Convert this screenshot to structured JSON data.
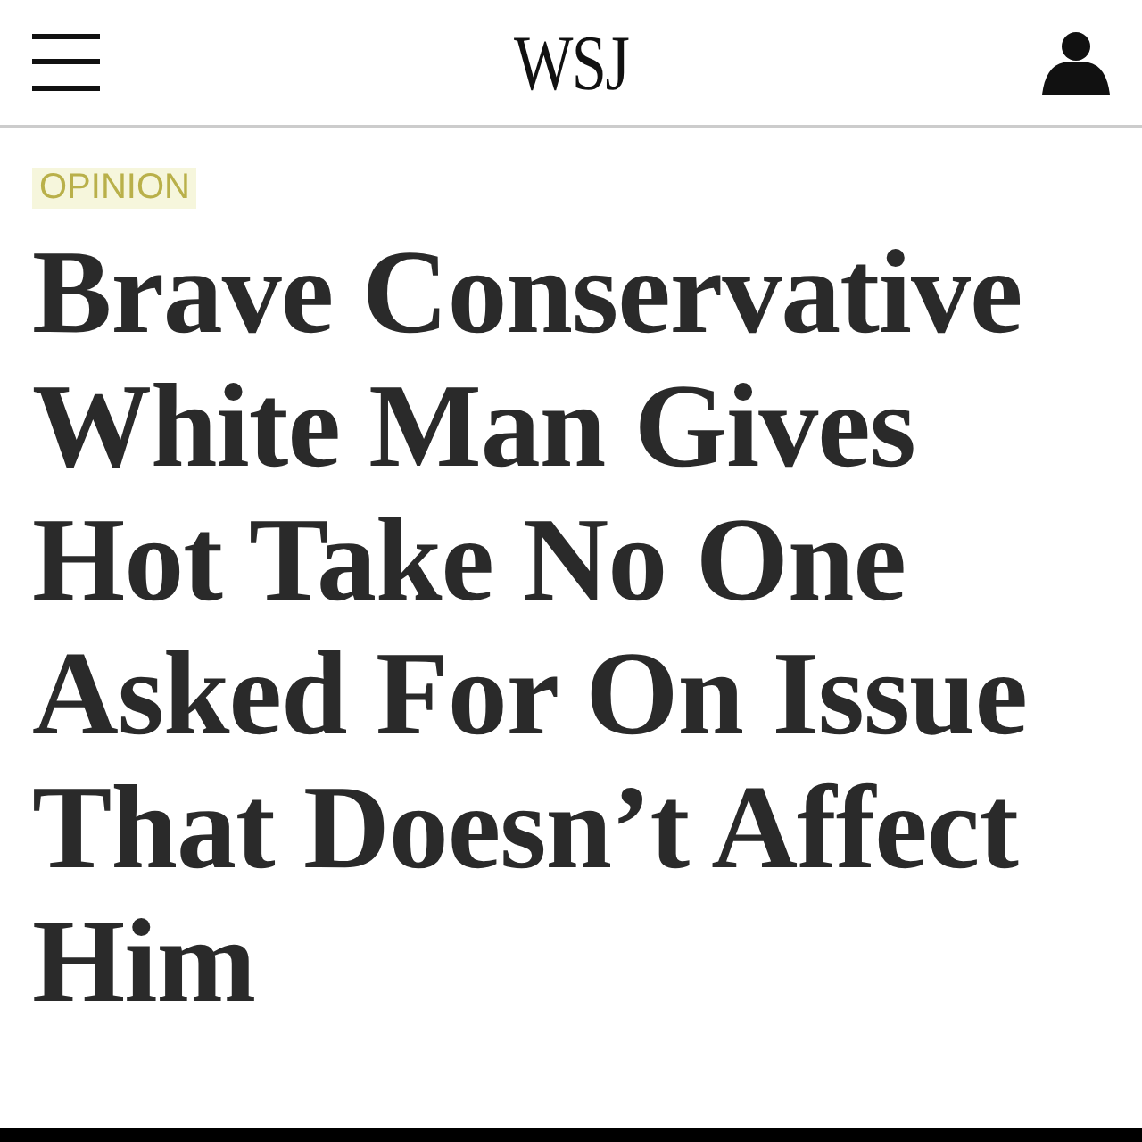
{
  "header": {
    "logo": "WSJ"
  },
  "section_label": "OPINION",
  "headline_lines": [
    "Brave Conservative",
    "White Man Gives",
    "Hot Take No One",
    "Asked For On Issue",
    "That Doesn’t Affect",
    "Him"
  ]
}
